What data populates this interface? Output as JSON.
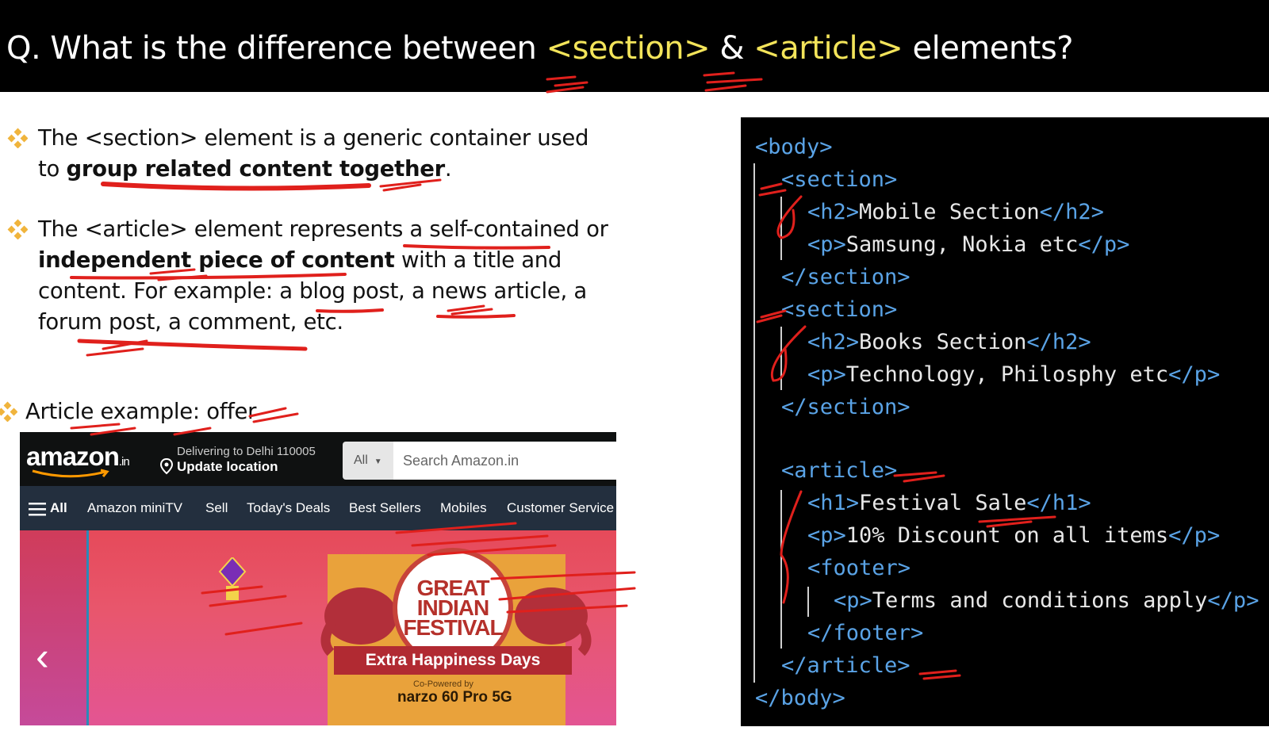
{
  "slide": {
    "title_pre": "Q. What is the difference between ",
    "title_tag1": "<section>",
    "title_amp": " & ",
    "title_tag2": "<article>",
    "title_post": " elements?",
    "bullet1_a": "The <section> element is a generic container used",
    "bullet1_b": "to ",
    "bullet1_bold": "group related content together",
    "bullet1_end": ".",
    "bullet2_a": "The <article> element represents a self-contained or",
    "bullet2_bold": "independent piece of content",
    "bullet2_b": " with a title and",
    "bullet2_c": "content. For example: a blog post, a news article, a",
    "bullet2_d": "forum post, a comment, etc.",
    "bullet3": "Article example: offer",
    "accent_color": "#f3e45a",
    "bullet_icon": "diamond-bullet-icon"
  },
  "amazon": {
    "logo": "amazon",
    "logo_suffix": ".in",
    "delivering": "Delivering to Delhi 110005",
    "update_location": "Update location",
    "search_category": "All",
    "search_placeholder": "Search Amazon.in",
    "nav": [
      "All",
      "Amazon miniTV",
      "Sell",
      "Today's Deals",
      "Best Sellers",
      "Mobiles",
      "Customer Service"
    ],
    "banner_title": "GREAT INDIAN FESTIVAL",
    "banner_ribbon": "Extra Happiness Days",
    "co_powered": "Co-Powered by",
    "sponsor": "narzo 60 Pro 5G"
  },
  "code": {
    "lines": [
      {
        "tag1": "<body>",
        "text": "",
        "tag2": ""
      },
      {
        "tag1": "<section>",
        "text": "",
        "tag2": ""
      },
      {
        "tag1": "<h2>",
        "text": "Mobile Section",
        "tag2": "</h2>"
      },
      {
        "tag1": "<p>",
        "text": "Samsung, Nokia etc",
        "tag2": "</p>"
      },
      {
        "tag1": "</section>",
        "text": "",
        "tag2": ""
      },
      {
        "tag1": "<section>",
        "text": "",
        "tag2": ""
      },
      {
        "tag1": "<h2>",
        "text": "Books Section",
        "tag2": "</h2>"
      },
      {
        "tag1": "<p>",
        "text": "Technology, Philosphy etc",
        "tag2": "</p>"
      },
      {
        "tag1": "</section>",
        "text": "",
        "tag2": ""
      },
      {
        "tag1": "<article>",
        "text": "",
        "tag2": ""
      },
      {
        "tag1": "<h1>",
        "text": "Festival Sale",
        "tag2": "</h1>"
      },
      {
        "tag1": "<p>",
        "text": "10% Discount on all items",
        "tag2": "</p>"
      },
      {
        "tag1": "<footer>",
        "text": "",
        "tag2": ""
      },
      {
        "tag1": "<p>",
        "text": "Terms and conditions apply",
        "tag2": "</p>"
      },
      {
        "tag1": "</footer>",
        "text": "",
        "tag2": ""
      },
      {
        "tag1": "</article>",
        "text": "",
        "tag2": ""
      },
      {
        "tag1": "</body>",
        "text": "",
        "tag2": ""
      }
    ],
    "tag_color": "#5aa3e6",
    "text_color": "#e8e8e8"
  }
}
